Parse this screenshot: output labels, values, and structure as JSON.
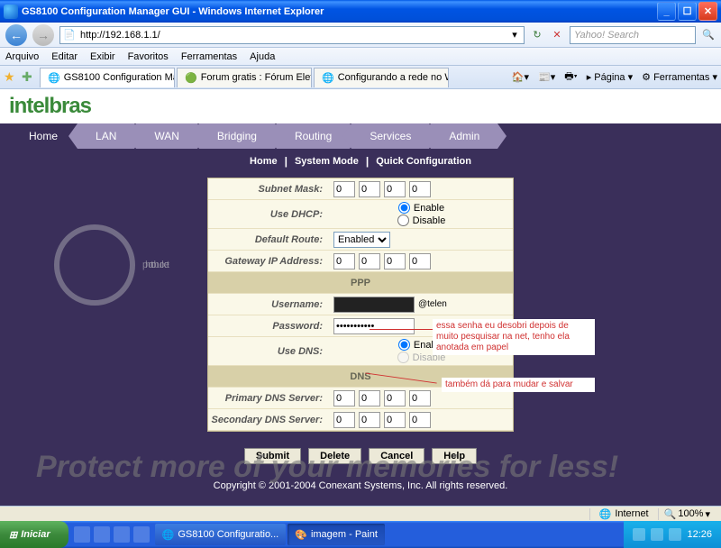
{
  "window": {
    "title": "GS8100 Configuration Manager GUI - Windows Internet Explorer"
  },
  "address_bar": {
    "url": "http://192.168.1.1/",
    "search_placeholder": "Yahoo! Search"
  },
  "menubar": [
    "Arquivo",
    "Editar",
    "Exibir",
    "Favoritos",
    "Ferramentas",
    "Ajuda"
  ],
  "tabs": [
    {
      "label": "GS8100 Configuration Ma...",
      "active": true
    },
    {
      "label": "Forum gratis : Fórum Eletrôni...",
      "active": false
    },
    {
      "label": "Configurando a rede no Win...",
      "active": false
    }
  ],
  "tabbar_right": {
    "pagina": "Página",
    "ferramentas": "Ferramentas"
  },
  "brand": "intelbras",
  "navtabs": [
    "Home",
    "LAN",
    "WAN",
    "Bridging",
    "Routing",
    "Services",
    "Admin"
  ],
  "breadcrumb": [
    "Home",
    "System Mode",
    "Quick Configuration"
  ],
  "form": {
    "subnet_mask_label": "Subnet Mask:",
    "subnet_mask": [
      "0",
      "0",
      "0",
      "0"
    ],
    "use_dhcp_label": "Use DHCP:",
    "enable": "Enable",
    "disable": "Disable",
    "default_route_label": "Default Route:",
    "default_route": "Enabled",
    "gateway_label": "Gateway IP Address:",
    "gateway": [
      "0",
      "0",
      "0",
      "0"
    ],
    "ppp_header": "PPP",
    "username_label": "Username:",
    "username_suffix": "@telen",
    "password_label": "Password:",
    "password": "•••••••••••",
    "use_dns_label": "Use DNS:",
    "dns_header": "DNS",
    "primary_dns_label": "Primary DNS Server:",
    "primary_dns": [
      "0",
      "0",
      "0",
      "0"
    ],
    "secondary_dns_label": "Secondary DNS Server:",
    "secondary_dns": [
      "0",
      "0",
      "0",
      "0"
    ]
  },
  "buttons": {
    "submit": "Submit",
    "delete": "Delete",
    "cancel": "Cancel",
    "help": "Help"
  },
  "copyright": "Copyright © 2001-2004 Conexant Systems, Inc. All rights reserved.",
  "watermark": {
    "logo": "photobucket",
    "tagline": "Protect more of your memories for less!"
  },
  "annotations": {
    "a1": "essa senha eu desobri depois de muito pesquisar na net, tenho ela anotada em papel",
    "a2": "também dá para mudar e salvar"
  },
  "statusbar": {
    "zone": "Internet",
    "zoom": "100%"
  },
  "taskbar": {
    "start": "Iniciar",
    "tasks": [
      {
        "label": "GS8100 Configuratio...",
        "active": false
      },
      {
        "label": "imagem - Paint",
        "active": true
      }
    ],
    "clock": "12:26"
  }
}
